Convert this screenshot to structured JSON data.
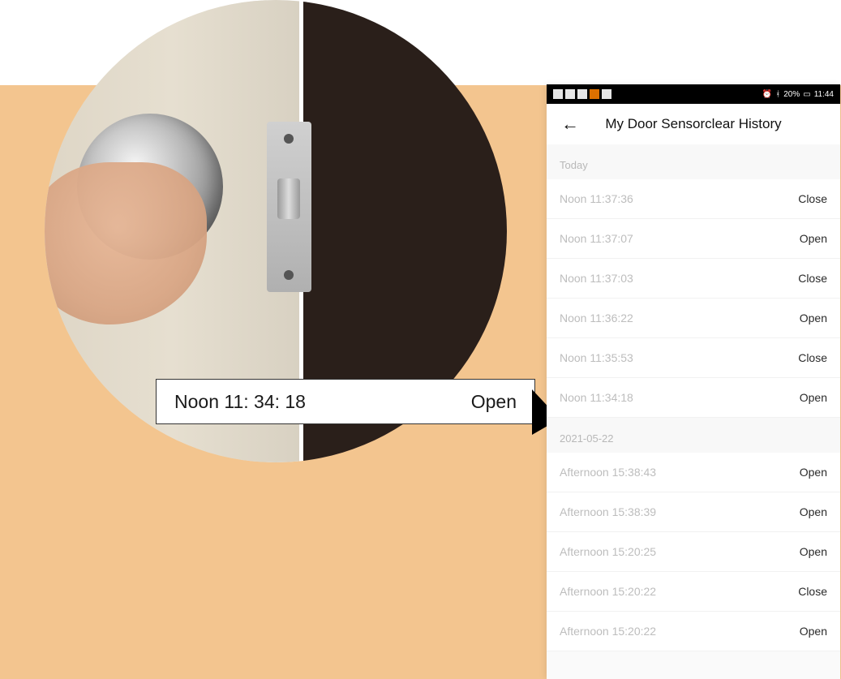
{
  "callout": {
    "time": "Noon 11:  34:  18",
    "status": "Open"
  },
  "phone": {
    "status_bar": {
      "right_text": "20%",
      "clock": "11:44"
    },
    "header": {
      "title": "My Door Sensor",
      "right_action": "clear History"
    },
    "sections": [
      {
        "label": "Today",
        "rows": [
          {
            "time": "Noon  11:37:36",
            "status": "Close"
          },
          {
            "time": "Noon  11:37:07",
            "status": "Open"
          },
          {
            "time": "Noon  11:37:03",
            "status": "Close"
          },
          {
            "time": "Noon  11:36:22",
            "status": "Open"
          },
          {
            "time": "Noon  11:35:53",
            "status": "Close"
          },
          {
            "time": "Noon  11:34:18",
            "status": "Open"
          }
        ]
      },
      {
        "label": "2021-05-22",
        "rows": [
          {
            "time": "Afternoon  15:38:43",
            "status": "Open"
          },
          {
            "time": "Afternoon  15:38:39",
            "status": "Open"
          },
          {
            "time": "Afternoon  15:20:25",
            "status": "Open"
          },
          {
            "time": "Afternoon  15:20:22",
            "status": "Close"
          },
          {
            "time": "Afternoon  15:20:22",
            "status": "Open"
          }
        ]
      }
    ]
  }
}
